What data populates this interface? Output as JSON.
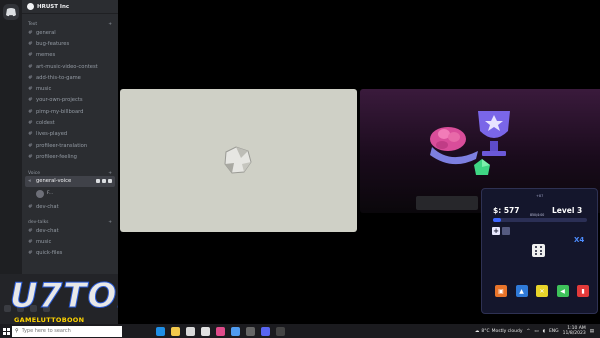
{
  "server": {
    "name": "HRUST Inc"
  },
  "categories": [
    {
      "label": "Text",
      "channels": [
        "general",
        "bug-features",
        "memes",
        "art-music-video-contest",
        "add-this-to-game",
        "music",
        "your-own-projects",
        "pimp-my-billboard",
        "coldest",
        "lives-played",
        "profileer-translation",
        "profileer-feeling"
      ]
    },
    {
      "label": "Voice",
      "voice_channel": "general-voice",
      "member": "F...",
      "channels": [
        "dev-chat"
      ]
    },
    {
      "label": "dev-talks",
      "channels": [
        "dev-chat",
        "music",
        "quick-files"
      ]
    }
  ],
  "branding": {
    "logo_main": "U7TOP",
    "logo_sub": "GAMELUTTOBOON"
  },
  "game": {
    "money": "$: 577",
    "level": "Level 3",
    "progress_label": "850/4:00",
    "progress_fraction": 0.08,
    "top_text": "+87",
    "multiplier": "X4",
    "plus": "+",
    "colors": {
      "accent": "#3e66ff",
      "panel": "#14162c"
    }
  },
  "taskbar": {
    "search_placeholder": "Type here to search",
    "weather": "Mostly cloudy",
    "temperature": "8°C",
    "language": "ENG",
    "time": "1:10 AM",
    "date": "11/8/2023"
  }
}
